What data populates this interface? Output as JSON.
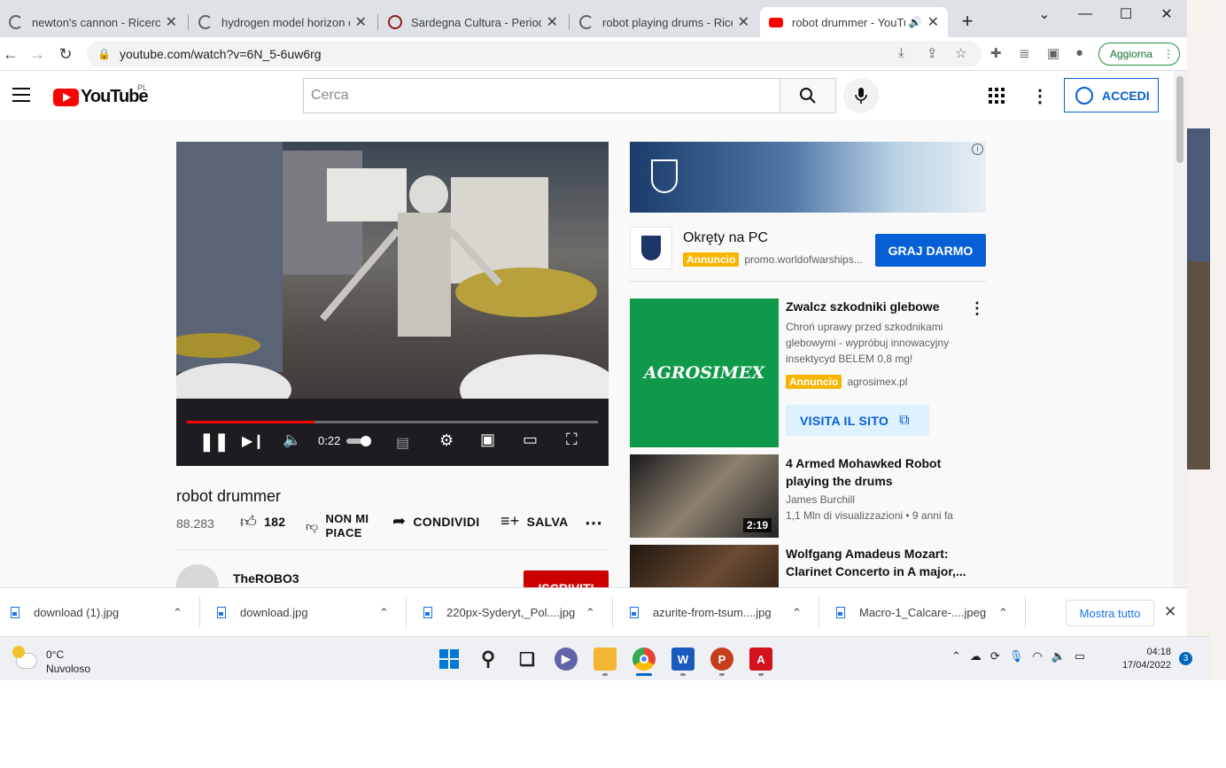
{
  "browser": {
    "tabs": [
      {
        "title": "newton's cannon - Ricerca Google",
        "icon": "google-icon"
      },
      {
        "title": "hydrogen model horizon car",
        "icon": "google-icon"
      },
      {
        "title": "Sardegna Cultura - Periodi st",
        "icon": "sardegna-icon"
      },
      {
        "title": "robot playing drums - Ricerca",
        "icon": "google-icon"
      },
      {
        "title": "robot drummer - YouTube",
        "icon": "youtube-icon"
      }
    ],
    "url": "youtube.com/watch?v=6N_5-6uw6rg",
    "update_label": "Aggiorna"
  },
  "youtube": {
    "logo_text": "YouTube",
    "region": "PL",
    "search_placeholder": "Cerca",
    "signin_label": "ACCEDI"
  },
  "video": {
    "time": "0:22",
    "progress_fraction": 0.31,
    "title": "robot drummer",
    "views": "88.283",
    "likes": "182",
    "dislike_label_1": "NON MI",
    "dislike_label_2": "PIACE",
    "share_label": "CONDIVIDI",
    "save_label": "SALVA",
    "channel": "TheROBO3",
    "subscribe_label": "ISCRIVITI"
  },
  "ad1": {
    "title": "Okręty na PC",
    "badge": "Annuncio",
    "url": "promo.worldofwarships...",
    "cta": "GRAJ DARMO"
  },
  "ad2": {
    "brand": "AGROSIMEX",
    "title": "Zwalcz szkodniki glebowe",
    "desc": "Chroń uprawy przed szkodnikami glebowymi - wypróbuj innowacyjny insektycyd BELEM 0,8 mg!",
    "badge": "Annuncio",
    "url": "agrosimex.pl",
    "cta": "VISITA IL SITO"
  },
  "recommendations": [
    {
      "title": "4 Armed Mohawked Robot playing the drums",
      "channel": "James Burchill",
      "meta": "1,1 Mln di visualizzazioni • 9 anni fa",
      "duration": "2:19"
    },
    {
      "title": "Wolfgang Amadeus Mozart: Clarinet Concerto in A major,...",
      "channel": "",
      "meta": "",
      "duration": ""
    }
  ],
  "downloads": [
    {
      "name": "download (1).jpg"
    },
    {
      "name": "download.jpg"
    },
    {
      "name": "220px-Syderyt,_Pol....jpg"
    },
    {
      "name": "azurite-from-tsum....jpg"
    },
    {
      "name": "Macro-1_Calcare-....jpeg"
    }
  ],
  "downloads_show_all": "Mostra tutto",
  "taskbar": {
    "temperature": "0°C",
    "weather": "Nuvoloso",
    "time": "04:18",
    "date": "17/04/2022",
    "notifications": "3"
  },
  "colors": {
    "youtube_red": "#ff0000",
    "subscribe": "#cc0000",
    "link_blue": "#065fd4",
    "annuncio": "#f9b400",
    "agro_green": "#0e9a4a"
  }
}
